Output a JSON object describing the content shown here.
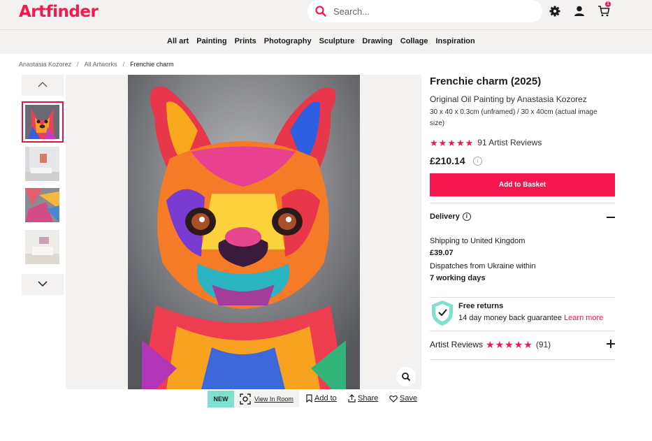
{
  "header": {
    "logo": "Artfinder",
    "search_placeholder": "Search...",
    "cart_count": "1"
  },
  "nav": {
    "items": [
      "All art",
      "Painting",
      "Prints",
      "Photography",
      "Sculpture",
      "Drawing",
      "Collage",
      "Inspiration"
    ]
  },
  "breadcrumb": [
    "Anastasia Kozorez",
    "All Artworks",
    "Frenchie charm"
  ],
  "gallery": {
    "thumbnails": [
      "artwork",
      "room-view",
      "detail",
      "room-view-2"
    ],
    "selected_index": 0
  },
  "actions": {
    "badge": "NEW",
    "view_in_room": "View In Room",
    "add_to": "Add to",
    "share": "Share",
    "save": "Save"
  },
  "product": {
    "title": "Frenchie charm (2025)",
    "subtitle": "Original Oil Painting by Anastasia Kozorez",
    "dimensions": "30 x 40 x 0.3cm (unframed) / 30 x 40cm (actual image size)",
    "rating_stars": 5,
    "rating_text": "91 Artist Reviews",
    "price": "£210.14",
    "add_to_basket": "Add to Basket"
  },
  "delivery": {
    "heading": "Delivery",
    "shipping_label": "Shipping to United Kingdom",
    "shipping_cost": "£39.07",
    "dispatch_label": "Dispatches from Ukraine within",
    "working_days": "7 working days"
  },
  "returns": {
    "title": "Free returns",
    "subtitle": "14 day money back guarantee",
    "link": "Learn more"
  },
  "reviews": {
    "label": "Artist Reviews",
    "count": "(91)"
  },
  "colors": {
    "brand": "#f5174d",
    "teal": "#7ee0cf",
    "panel": "#f3f2f1"
  }
}
